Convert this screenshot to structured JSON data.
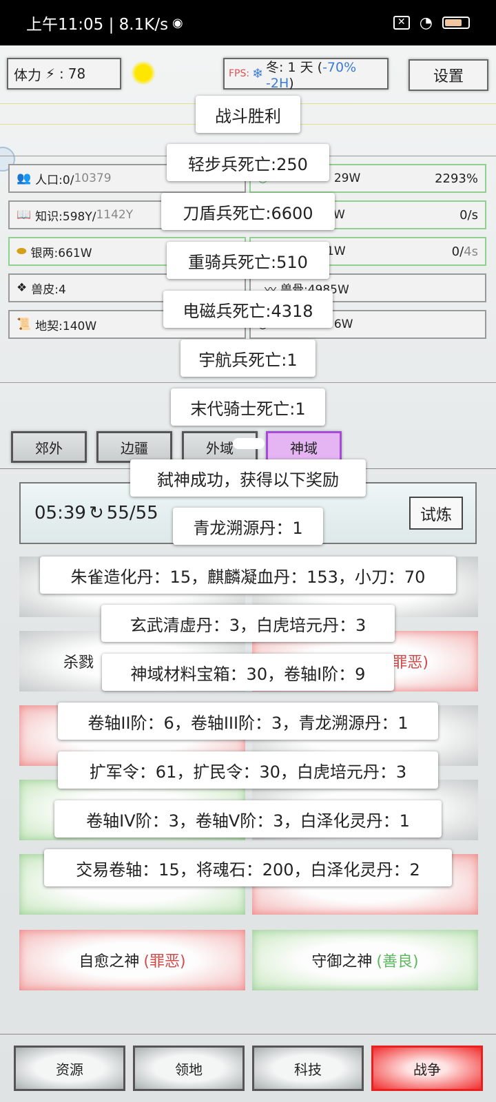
{
  "status_bar": {
    "time_speed": "上午11:05 | 8.1K/s"
  },
  "top": {
    "stamina_label": "体力",
    "stamina_value": "78",
    "fps_label": "FPS:",
    "season_text": "冬: 1 天 (",
    "season_effect": "-70% -2H",
    "season_close": ")",
    "settings": "设置"
  },
  "resources": {
    "population": "人口:0/",
    "population_max": "10379",
    "knowledge": "知识:598Y/",
    "knowledge_max": "1142Y",
    "silver": "银两:661W",
    "hide": "兽皮:4",
    "land_deed": "地契:140W",
    "r1_partial": "29W",
    "r1_right": "2293%",
    "r2_partial": "W",
    "r2_right": "0/s",
    "r3_partial": "1W",
    "r3_right_a": "0/",
    "r3_right_b": "4s",
    "r4_partial": "兽骨:4985W",
    "r5_partial": "6W"
  },
  "tabs": [
    "郊外",
    "边疆",
    "外域",
    "神域"
  ],
  "trial": {
    "timer": "05:39",
    "count": "55/55",
    "button": "试炼"
  },
  "gods": {
    "g1_name": "杀戮",
    "g2_tag": "罪恶)",
    "g3_name": "自愈之神",
    "g3_tag": "(罪恶)",
    "g4_name": "守御之神",
    "g4_tag": "(善良)"
  },
  "toasts": [
    "战斗胜利",
    "轻步兵死亡:250",
    "刀盾兵死亡:6600",
    "重骑兵死亡:510",
    "电磁兵死亡:4318",
    "宇航兵死亡:1",
    "末代骑士死亡:1",
    "弑神成功，获得以下奖励",
    "青龙溯源丹：1",
    "朱雀造化丹：15，麒麟凝血丹：153，小刀：70",
    "玄武清虚丹：3，白虎培元丹：3",
    "神域材料宝箱：30，卷轴I阶：9",
    "卷轴II阶：6，卷轴III阶：3，青龙溯源丹：1",
    "扩军令：61，扩民令：30，白虎培元丹：3",
    "卷轴IV阶：3，卷轴V阶：3，白泽化灵丹：1",
    "交易卷轴：15，将魂石：200，白泽化灵丹：2"
  ],
  "bottom_nav": [
    "资源",
    "领地",
    "科技",
    "战争"
  ],
  "colors": {
    "accent_blue": "#3a7bd5",
    "evil_red": "#d24a4a",
    "good_green": "#5cb85c",
    "active_tab": "#a64ad8",
    "active_nav": "#e82020"
  }
}
